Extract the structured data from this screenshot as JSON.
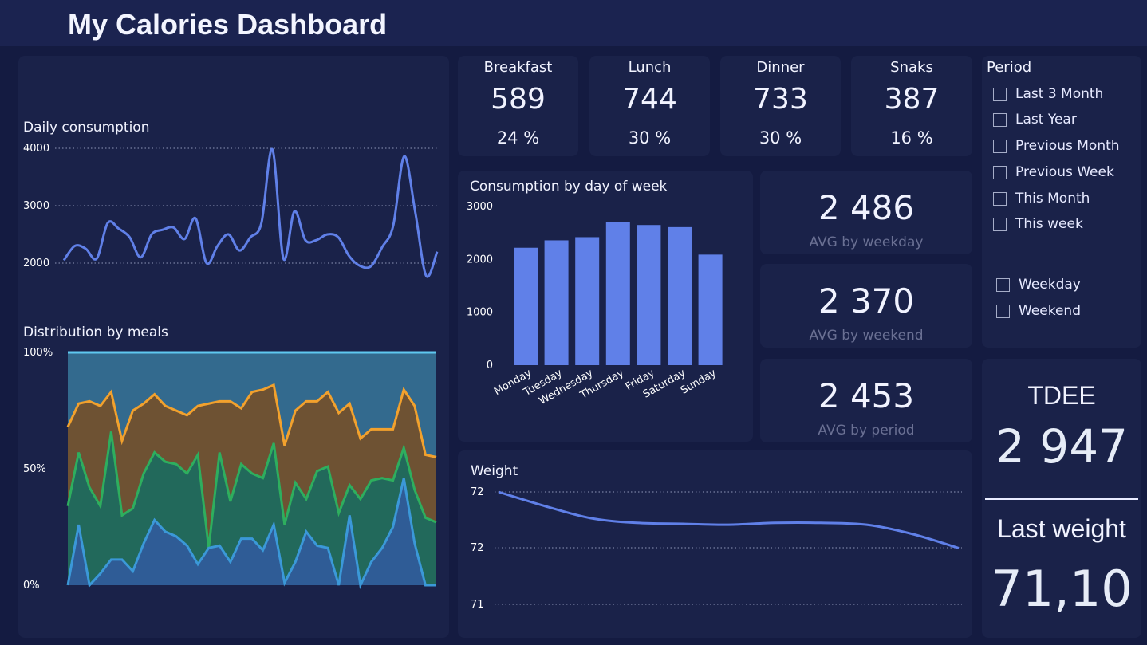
{
  "title": "My Calories Dashboard",
  "meals": [
    {
      "label": "Breakfast",
      "value": "589",
      "pct": "24 %"
    },
    {
      "label": "Lunch",
      "value": "744",
      "pct": "30 %"
    },
    {
      "label": "Dinner",
      "value": "733",
      "pct": "30 %"
    },
    {
      "label": "Snaks",
      "value": "387",
      "pct": "16 %"
    }
  ],
  "averages": [
    {
      "value": "2 486",
      "label": "AVG by weekday"
    },
    {
      "value": "2 370",
      "label": "AVG by weekend"
    },
    {
      "value": "2 453",
      "label": "AVG by period"
    }
  ],
  "period": {
    "title": "Period",
    "options": [
      "Last 3 Month",
      "Last Year",
      "Previous Month",
      "Previous Week",
      "This Month",
      "This week"
    ],
    "day_options": [
      "Weekday",
      "Weekend"
    ]
  },
  "tdee": {
    "label": "TDEE",
    "value": "2 947"
  },
  "last_weight": {
    "label": "Last weight",
    "value": "71,10"
  },
  "colors": {
    "accent": "#6080e8",
    "background": "#141b41",
    "card": "#1a2249"
  },
  "chart_data": [
    {
      "type": "line",
      "title": "Daily consumption",
      "y_ticks": [
        "2000",
        "3000",
        "4000"
      ],
      "ylim": [
        2000,
        4000
      ],
      "grid": true,
      "values": [
        2050,
        2300,
        2250,
        2080,
        2700,
        2600,
        2450,
        2100,
        2500,
        2580,
        2620,
        2420,
        2780,
        2000,
        2300,
        2500,
        2220,
        2450,
        2700,
        3980,
        2080,
        2900,
        2400,
        2400,
        2500,
        2450,
        2120,
        1950,
        1950,
        2280,
        2650,
        3860,
        2900,
        1780,
        2200
      ]
    },
    {
      "type": "area",
      "title": "Distribution by meals",
      "y_ticks": [
        "0%",
        "50%",
        "100%"
      ],
      "ylim": [
        0,
        100
      ],
      "stacked": true,
      "series": [
        {
          "color": "#3b98d8",
          "values": [
            0,
            26,
            0,
            5,
            11,
            11,
            6,
            18,
            28,
            23,
            21,
            17,
            9,
            16,
            17,
            10,
            20,
            20,
            15,
            26,
            1,
            10,
            23,
            17,
            16,
            0,
            30,
            0,
            10,
            16,
            25,
            46,
            18,
            0,
            0
          ]
        },
        {
          "color": "#2eae5e",
          "values": [
            34,
            57,
            42,
            34,
            66,
            30,
            33,
            48,
            57,
            53,
            52,
            48,
            56,
            16,
            57,
            36,
            52,
            48,
            46,
            61,
            26,
            44,
            37,
            49,
            51,
            31,
            43,
            37,
            45,
            46,
            45,
            59,
            41,
            29,
            27
          ]
        },
        {
          "color": "#f2a12d",
          "values": [
            68,
            78,
            79,
            77,
            83,
            62,
            75,
            78,
            82,
            77,
            75,
            73,
            77,
            78,
            79,
            79,
            76,
            83,
            84,
            86,
            60,
            75,
            79,
            79,
            83,
            74,
            78,
            63,
            67,
            67,
            67,
            84,
            77,
            56,
            55
          ]
        },
        {
          "color": "#5fc8f0",
          "values": [
            100,
            100,
            100,
            100,
            100,
            100,
            100,
            100,
            100,
            100,
            100,
            100,
            100,
            100,
            100,
            100,
            100,
            100,
            100,
            100,
            100,
            100,
            100,
            100,
            100,
            100,
            100,
            100,
            100,
            100,
            100,
            100,
            100,
            100,
            100
          ]
        }
      ]
    },
    {
      "type": "bar",
      "title": "Consumption by day of week",
      "categories": [
        "Monday",
        "Tuesday",
        "Wednesday",
        "Thursday",
        "Friday",
        "Saturday",
        "Sunday"
      ],
      "values": [
        2220,
        2360,
        2420,
        2700,
        2650,
        2610,
        2090
      ],
      "y_ticks": [
        "0",
        "1000",
        "2000",
        "3000"
      ],
      "ylim": [
        0,
        3000
      ]
    },
    {
      "type": "line",
      "title": "Weight",
      "y_ticks": [
        "71",
        "72",
        "72"
      ],
      "ylim": [
        71,
        72.2
      ],
      "grid": true,
      "values": [
        72.2,
        72.05,
        71.92,
        71.87,
        71.86,
        71.85,
        71.87,
        71.87,
        71.85,
        71.75,
        71.6
      ]
    }
  ]
}
